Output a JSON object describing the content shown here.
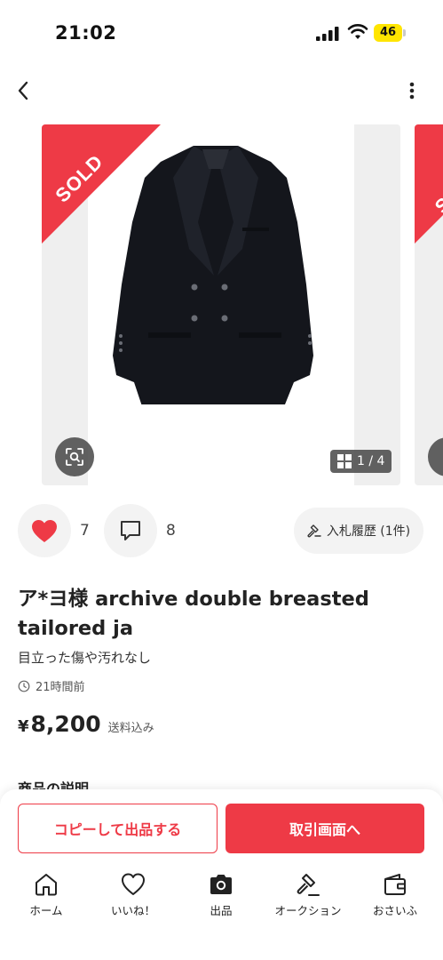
{
  "status_bar": {
    "time": "21:02",
    "battery": "46"
  },
  "item": {
    "sold_label": "SOLD",
    "image_counter": "1 / 4",
    "title": "ア*ヨ様 archive double breasted tailored ja",
    "condition": "目立った傷や汚れなし",
    "posted": "21時間前",
    "currency": "¥",
    "price": "8,200",
    "shipping": "送料込み",
    "description_heading": "商品の説明"
  },
  "actions": {
    "like_count": "7",
    "comment_count": "8",
    "bid_history": "入札履歴 (1件)"
  },
  "buttons": {
    "copy_listing": "コピーして出品する",
    "to_transaction": "取引画面へ"
  },
  "tabs": [
    {
      "label": "ホーム",
      "icon": "home-icon"
    },
    {
      "label": "いいね！",
      "icon": "heart-outline-icon"
    },
    {
      "label": "出品",
      "icon": "camera-icon"
    },
    {
      "label": "オークション",
      "icon": "gavel-icon"
    },
    {
      "label": "おさいふ",
      "icon": "wallet-icon"
    }
  ],
  "colors": {
    "accent": "#ee3a46",
    "battery": "#ffe500"
  }
}
